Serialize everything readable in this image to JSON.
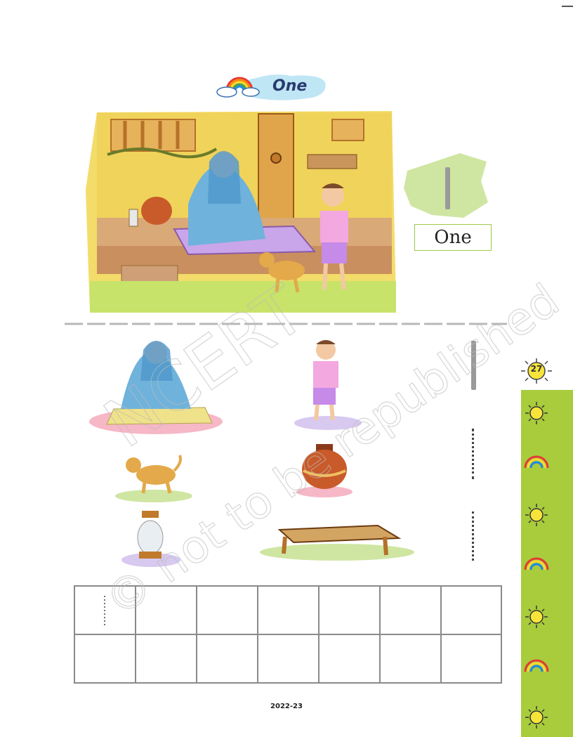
{
  "header": {
    "title": "One"
  },
  "number_card": {
    "word": "One"
  },
  "page": {
    "number": "27",
    "footer": "2022-23"
  },
  "watermark": {
    "line1": "NCERT",
    "line2": "© not to be republished"
  },
  "strip_icons": [
    "sun-icon",
    "rainbow-icon",
    "sun-icon",
    "rainbow-icon",
    "sun-icon",
    "rainbow-icon",
    "sun-icon"
  ],
  "colors": {
    "strip_green": "#a8cc3c",
    "title_blue": "#2a3b6e",
    "sky_cloud": "#bfe6f5"
  }
}
